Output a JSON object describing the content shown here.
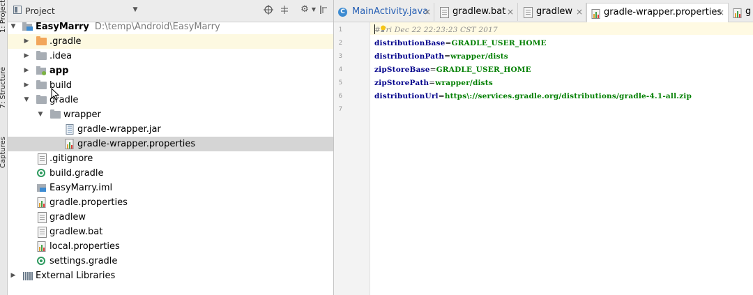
{
  "sidebar_tabs": [
    "1: Project",
    "7: Structure",
    "Captures"
  ],
  "project_panel": {
    "title": "Project",
    "tree": [
      {
        "label": "EasyMarry",
        "path": "D:\\temp\\Android\\EasyMarry",
        "bold": true
      },
      {
        "label": ".gradle"
      },
      {
        "label": ".idea"
      },
      {
        "label": "app",
        "bold": true
      },
      {
        "label": "build"
      },
      {
        "label": "gradle"
      },
      {
        "label": "wrapper"
      },
      {
        "label": "gradle-wrapper.jar"
      },
      {
        "label": "gradle-wrapper.properties",
        "selected": true
      },
      {
        "label": ".gitignore"
      },
      {
        "label": "build.gradle"
      },
      {
        "label": "EasyMarry.iml"
      },
      {
        "label": "gradle.properties"
      },
      {
        "label": "gradlew"
      },
      {
        "label": "gradlew.bat"
      },
      {
        "label": "local.properties"
      },
      {
        "label": "settings.gradle"
      },
      {
        "label": "External Libraries"
      }
    ]
  },
  "editor": {
    "tabs": [
      {
        "label": "MainActivity.java",
        "icon": "class-icon"
      },
      {
        "label": "gradlew.bat",
        "icon": "file-icon"
      },
      {
        "label": "gradlew",
        "icon": "file-icon"
      },
      {
        "label": "gradle-wrapper.properties",
        "icon": "properties-icon",
        "active": true
      },
      {
        "label": "g",
        "icon": "properties-icon"
      }
    ],
    "line_numbers": [
      "1",
      "2",
      "3",
      "4",
      "5",
      "6",
      "7"
    ],
    "lines": [
      {
        "comment": "#Fri Dec 22 22:23:23 CST 2017"
      },
      {
        "key": "distributionBase",
        "value": "GRADLE_USER_HOME"
      },
      {
        "key": "distributionPath",
        "value": "wrapper/dists"
      },
      {
        "key": "zipStoreBase",
        "value": "GRADLE_USER_HOME"
      },
      {
        "key": "zipStorePath",
        "value": "wrapper/dists"
      },
      {
        "key": "distributionUrl",
        "value": "https\\://services.gradle.org/distributions/gradle-4.1-all.zip"
      }
    ],
    "eq": "="
  },
  "colors": {
    "key": "#00008b",
    "value": "#007f00",
    "selection": "#d5d5d5",
    "highlight": "#fdf9e1"
  }
}
